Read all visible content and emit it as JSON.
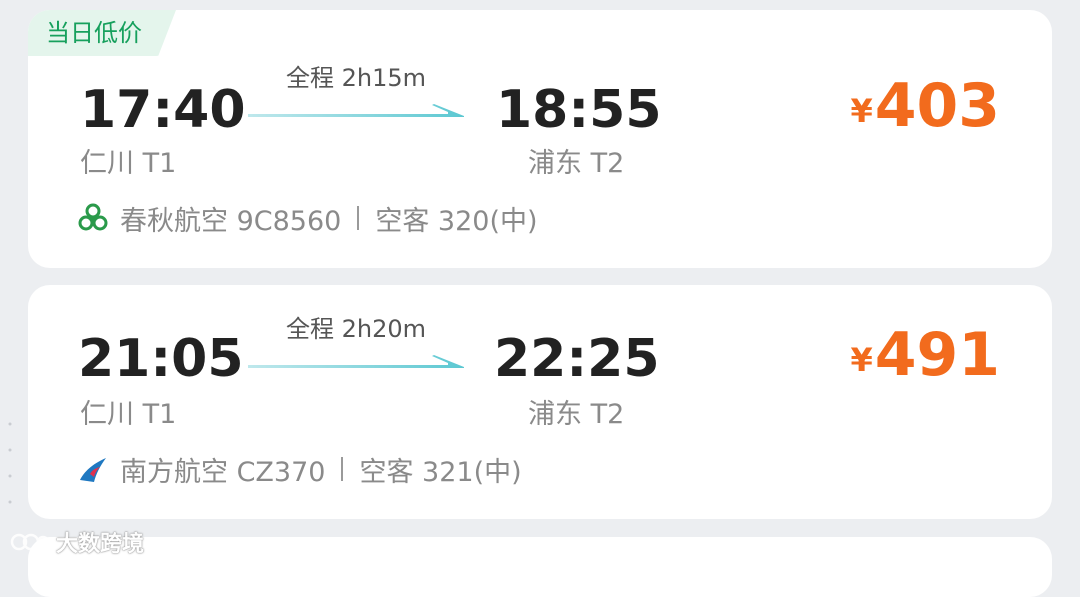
{
  "flights": [
    {
      "badge": "当日低价",
      "departure_time": "17:40",
      "departure_airport": "仁川 T1",
      "duration": "全程 2h15m",
      "arrival_time": "18:55",
      "arrival_airport": "浦东 T2",
      "currency": "¥",
      "price": "403",
      "airline_icon": "spring-airlines-logo-icon",
      "airline_flight": "春秋航空 9C8560",
      "aircraft": "空客 320(中)"
    },
    {
      "departure_time": "21:05",
      "departure_airport": "仁川 T1",
      "duration": "全程 2h20m",
      "arrival_time": "22:25",
      "arrival_airport": "浦东 T2",
      "currency": "¥",
      "price": "491",
      "airline_icon": "china-southern-logo-icon",
      "airline_flight": "南方航空 CZ370",
      "aircraft": "空客 321(中)"
    }
  ],
  "watermark": "大数跨境",
  "colors": {
    "price": "#f26b1d",
    "badge_bg": "#e4f5ec",
    "badge_text": "#17a05d",
    "arrow": "#66cdd6",
    "time": "#222222",
    "muted": "#8a8a8a"
  }
}
